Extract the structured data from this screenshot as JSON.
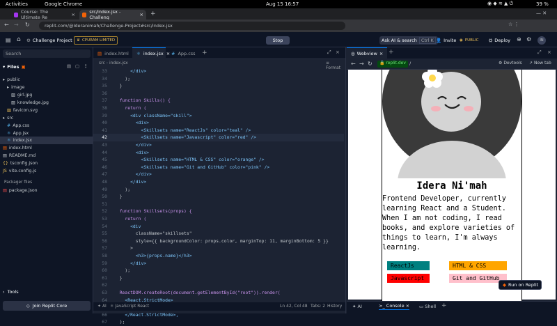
{
  "os": {
    "activities": "Activities",
    "app": "Google Chrome",
    "datetime": "Aug 15  16:57",
    "battery": "39 %"
  },
  "chrome": {
    "tabs": [
      {
        "label": "Course: The Ultimate Re"
      },
      {
        "label": "src/index.jsx - Challeng"
      }
    ],
    "url": "replit.com/@Ideranimah/Challenge-Project#src/index.jsx"
  },
  "header": {
    "project": "Challenge Project",
    "badge": "CPURAM LIMITED",
    "run": "Stop",
    "ask_ai": "Ask AI & search",
    "shortcut": "Ctrl K",
    "invite": "Invite",
    "public": "PUBLIC",
    "deploy": "Deploy",
    "avatar": "IN"
  },
  "sidebar": {
    "search_placeholder": "Search",
    "files_label": "Files",
    "items": [
      {
        "label": "public",
        "type": "folder"
      },
      {
        "label": "image",
        "type": "folder"
      },
      {
        "label": "girl.jpg",
        "type": "image"
      },
      {
        "label": "knowledge.jpg",
        "type": "image"
      },
      {
        "label": "favicon.svg",
        "type": "image"
      },
      {
        "label": "src",
        "type": "folder"
      },
      {
        "label": "App.css",
        "type": "css"
      },
      {
        "label": "App.jsx",
        "type": "jsx"
      },
      {
        "label": "index.jsx",
        "type": "jsx",
        "selected": true
      },
      {
        "label": "index.html",
        "type": "html"
      },
      {
        "label": "README.md",
        "type": "md"
      },
      {
        "label": "tsconfig.json",
        "type": "json"
      },
      {
        "label": "vite.config.js",
        "type": "js"
      }
    ],
    "packager_label": "Packager files",
    "packager_items": [
      {
        "label": "package.json"
      }
    ],
    "tools_label": "Tools",
    "join_core": "Join Replit Core"
  },
  "editor": {
    "tabs": [
      {
        "label": "index.html"
      },
      {
        "label": "index.jsx",
        "active": true
      },
      {
        "label": "App.css"
      }
    ],
    "breadcrumb_src": "src",
    "breadcrumb_file": "index.jsx",
    "format_label": "Format",
    "lines": [
      {
        "n": "33",
        "text": "      </div>"
      },
      {
        "n": "34",
        "text": "    );"
      },
      {
        "n": "35",
        "text": "  }"
      },
      {
        "n": "36",
        "text": ""
      },
      {
        "n": "37",
        "text": "  function Skills() {"
      },
      {
        "n": "38",
        "text": "    return ("
      },
      {
        "n": "39",
        "text": "      <div className=\"skill\">"
      },
      {
        "n": "40",
        "text": "        <div>"
      },
      {
        "n": "41",
        "text": "          <Skillsets name=\"ReactJs\" color=\"teal\" />"
      },
      {
        "n": "42",
        "text": "          <Skillsets name=\"Javascript\" color=\"red\" />"
      },
      {
        "n": "43",
        "text": "        </div>"
      },
      {
        "n": "44",
        "text": "        <div>"
      },
      {
        "n": "45",
        "text": "          <Skillsets name=\"HTML & CSS\" color=\"orange\" />"
      },
      {
        "n": "46",
        "text": "          <Skillsets name=\"Git and GitHub\" color=\"pink\" />"
      },
      {
        "n": "47",
        "text": "        </div>"
      },
      {
        "n": "48",
        "text": "      </div>"
      },
      {
        "n": "49",
        "text": "    );"
      },
      {
        "n": "50",
        "text": "  }"
      },
      {
        "n": "51",
        "text": ""
      },
      {
        "n": "52",
        "text": "  function Skillsets(props) {"
      },
      {
        "n": "53",
        "text": "    return ("
      },
      {
        "n": "54",
        "text": "      <div"
      },
      {
        "n": "55",
        "text": "        className=\"skillsets\""
      },
      {
        "n": "56",
        "text": "        style={{ backgroundColor: props.color, marginTop: 11, marginBottom: 5 }}"
      },
      {
        "n": "57",
        "text": "      >"
      },
      {
        "n": "58",
        "text": "        <h3>{props.name}</h3>"
      },
      {
        "n": "59",
        "text": "      </div>"
      },
      {
        "n": "60",
        "text": "    );"
      },
      {
        "n": "61",
        "text": "  }"
      },
      {
        "n": "62",
        "text": ""
      },
      {
        "n": "63",
        "text": "  ReactDOM.createRoot(document.getElementById(\"root\")).render("
      },
      {
        "n": "64",
        "text": "    <React.StrictMode>"
      },
      {
        "n": "65",
        "text": "      <App />"
      },
      {
        "n": "66",
        "text": "    </React.StrictMode>,"
      },
      {
        "n": "67",
        "text": "  );"
      }
    ],
    "status_ai": "AI",
    "status_lang": "JavaScript React",
    "status_pos": "Ln 42, Col 48",
    "status_tabs": "Tabs: 2",
    "status_history": "History"
  },
  "webview": {
    "tab_label": "Webview",
    "url": "replit.dev",
    "path": "/",
    "devtools": "Devtools",
    "new_tab": "New tab",
    "profile_name": "Idera Ni'mah",
    "bio": "Frontend Developer, currently learning React and a Student. When I am not coding, I read books, and explore varieties of things to learn, I'm always learning.",
    "skills": [
      {
        "name": "ReactJs",
        "color": "#008080"
      },
      {
        "name": "HTML & CSS",
        "color": "#ffa500"
      },
      {
        "name": "Javascript",
        "color": "#ff0000"
      },
      {
        "name": "Git and GitHub",
        "color": "#ffc0cb"
      }
    ],
    "run_on_replit": "Run on Replit",
    "bottom_tabs": [
      {
        "label": "AI"
      },
      {
        "label": "Console"
      },
      {
        "label": "Shell"
      }
    ]
  }
}
